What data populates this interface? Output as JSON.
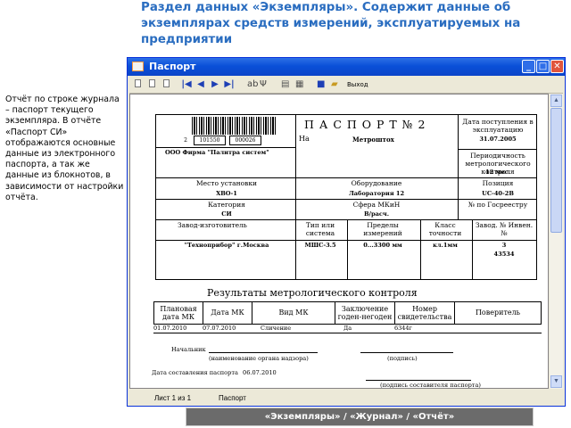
{
  "heading": "Раздел данных «Экземпляры». Содержит данные об экземплярах средств измерений, эксплуатируемых на предприятии",
  "side_note": "Отчёт по строке журнала – паспорт текущего экземпляра. В отчёте «Паспорт СИ» отображаются основные данные из электронного паспорта, а так же данные из блокнотов, в зависимости от настройки отчёта.",
  "window": {
    "title": "Паспорт",
    "title_icon": "app-window-icon",
    "controls": {
      "minimize": "_",
      "maximize": "□",
      "close": "✕"
    },
    "toolbar": {
      "first": "|◀",
      "prev": "◀",
      "next": "▶",
      "last": "▶|",
      "back": "⇐",
      "forward": "⇒",
      "exit_label": "Выход"
    },
    "status": {
      "page": "Лист 1 из 1",
      "name": "Паспорт"
    }
  },
  "passport": {
    "barcode_digits": [
      "2",
      "101550",
      "000026"
    ],
    "title": "П А С П О Р Т   № 2",
    "on_label": "На",
    "on_value": "Метроштох",
    "org": "ООО Фирма \"Палитра систем\"",
    "date_label": "Дата поступления в эксплуатацию",
    "date_value": "31.07.2005",
    "period_label": "Периодичность метрологического контроля",
    "period_value": "12 мес.",
    "place_label": "Место установки",
    "place_value": "ХВО-1",
    "equip_label": "Оборудование",
    "equip_value": "Лаборатория 12",
    "pos_label": "Позиция",
    "pos_value": "UC-40-2B",
    "cat_label": "Категория",
    "cat_value": "СИ",
    "sphere_label": "Сфера МКиН",
    "sphere_value": "В/расч.",
    "reg_label": "№ по Госреестру",
    "reg_value": "",
    "maker_label": "Завод-изготовитель",
    "maker_value": "\"Техноприбор\" г.Москва",
    "type_label": "Тип или система",
    "type_value": "МШС-3.5",
    "limits_label": "Пределы измерений",
    "limits_value": "0...3300 мм",
    "class_label": "Класс точности",
    "class_value": "кл.1мм",
    "factory_label": "Завод. № Инвен. №",
    "factory_value": "3",
    "inv_value": "43534"
  },
  "results": {
    "title": "Результаты метрологического контроля",
    "headers": [
      "Плановая дата МК",
      "Дата МК",
      "Вид МК",
      "Заключение годен-негоден",
      "Номер свидетельства",
      "Поверитель"
    ],
    "rows": [
      [
        "01.07.2010",
        "07.07.2010",
        "Сличение",
        "Да",
        "6344г",
        ""
      ]
    ]
  },
  "signatures": {
    "head_label": "Начальник",
    "org_caption": "(наименование органа надзора)",
    "sign_caption": "(подпись)",
    "date_label": "Дата составления паспорта",
    "date_value": "06.07.2010",
    "sign2_caption": "(подпись составителя паспорта)"
  },
  "caption": "«Экземпляры» / «Журнал» / «Отчёт»",
  "colors": {
    "heading": "#2a6dc0",
    "titlebar": "#0a50d8",
    "caption_bg": "#6b6b6b"
  }
}
